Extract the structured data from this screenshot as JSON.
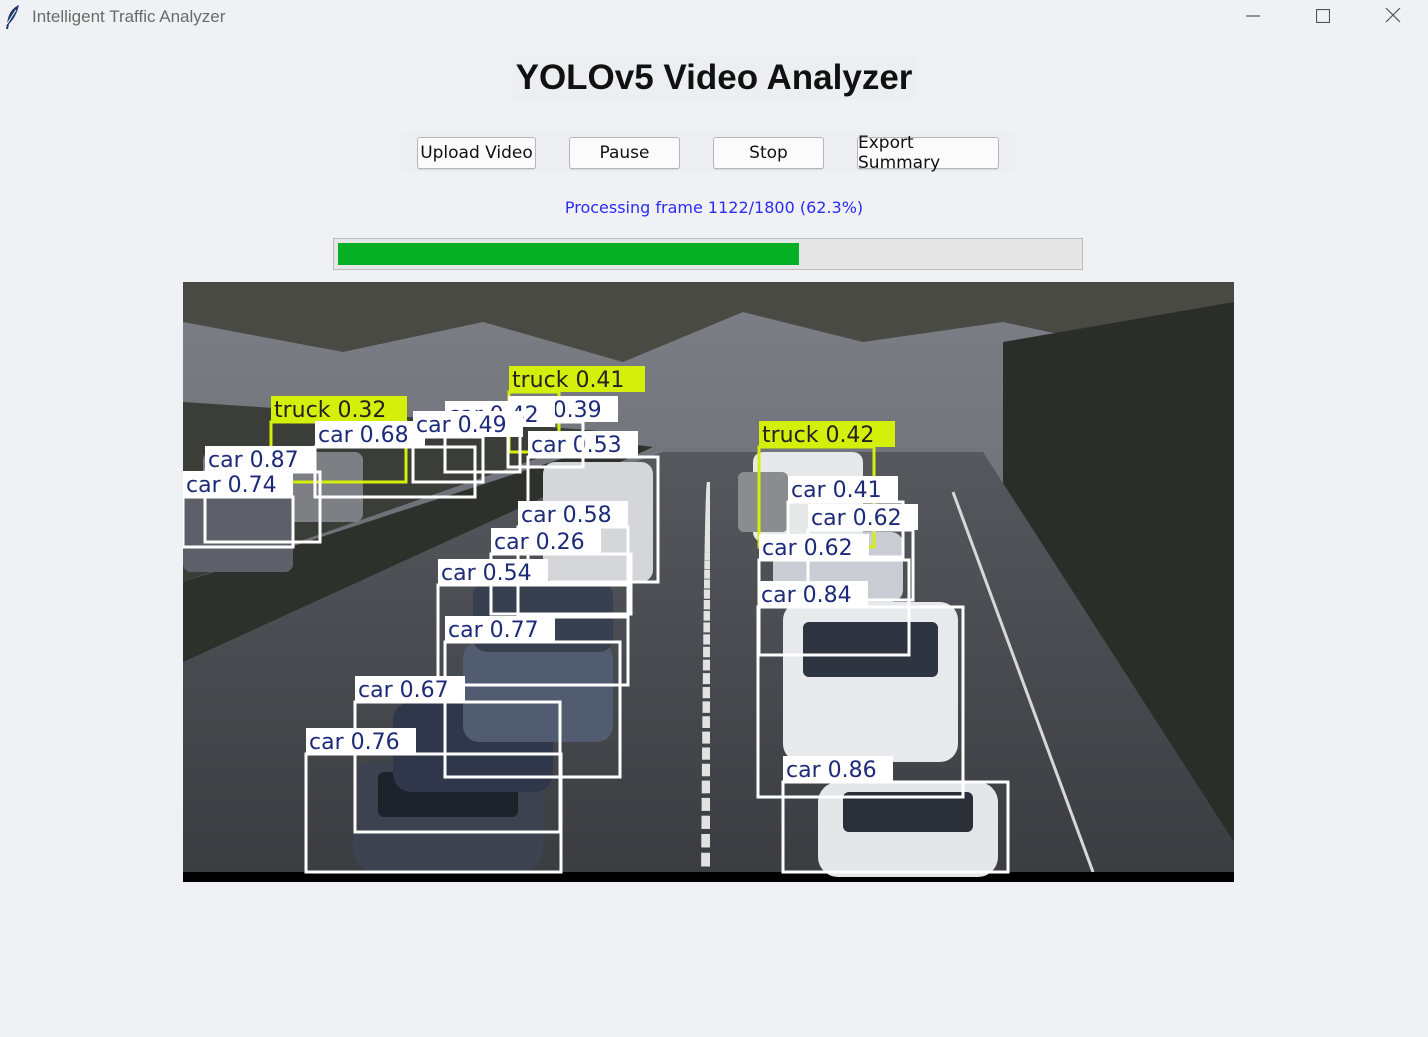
{
  "window": {
    "title": "Intelligent Traffic Analyzer",
    "app_icon": "feather-icon",
    "controls": [
      "minimize-icon",
      "maximize-icon",
      "close-icon"
    ]
  },
  "main": {
    "heading": "YOLOv5 Video Analyzer",
    "buttons": {
      "upload": "Upload Video",
      "pause": "Pause",
      "stop": "Stop",
      "export": "Export Summary"
    },
    "status_text": "Processing frame 1122/1800 (62.3%)",
    "progress_fraction": 0.623
  },
  "video": {
    "detections": [
      {
        "label": "truck 0.32"
      },
      {
        "label": "truck 0.41"
      },
      {
        "label": "truck 0.42"
      },
      {
        "label": "car 0.68"
      },
      {
        "label": "car 0.87"
      },
      {
        "label": "car 0.74"
      },
      {
        "label": "car 0.53"
      },
      {
        "label": "car 0.58"
      },
      {
        "label": "car 0.26"
      },
      {
        "label": "car 0.54"
      },
      {
        "label": "car 0.77"
      },
      {
        "label": "car 0.67"
      },
      {
        "label": "car 0.76"
      },
      {
        "label": "car 0.41"
      },
      {
        "label": "car 0.62"
      },
      {
        "label": "car 0.62"
      },
      {
        "label": "car 0.84"
      },
      {
        "label": "car 0.86"
      },
      {
        "label": "car 0.39"
      },
      {
        "label": "car 0.42"
      },
      {
        "label": "car 0.49"
      }
    ]
  },
  "colors": {
    "status": "#2a2cf0",
    "progress_fill": "#06b025",
    "car_box": "#ffffff",
    "car_label_text": "#1c2a78",
    "truck_box": "#d4f00a"
  }
}
